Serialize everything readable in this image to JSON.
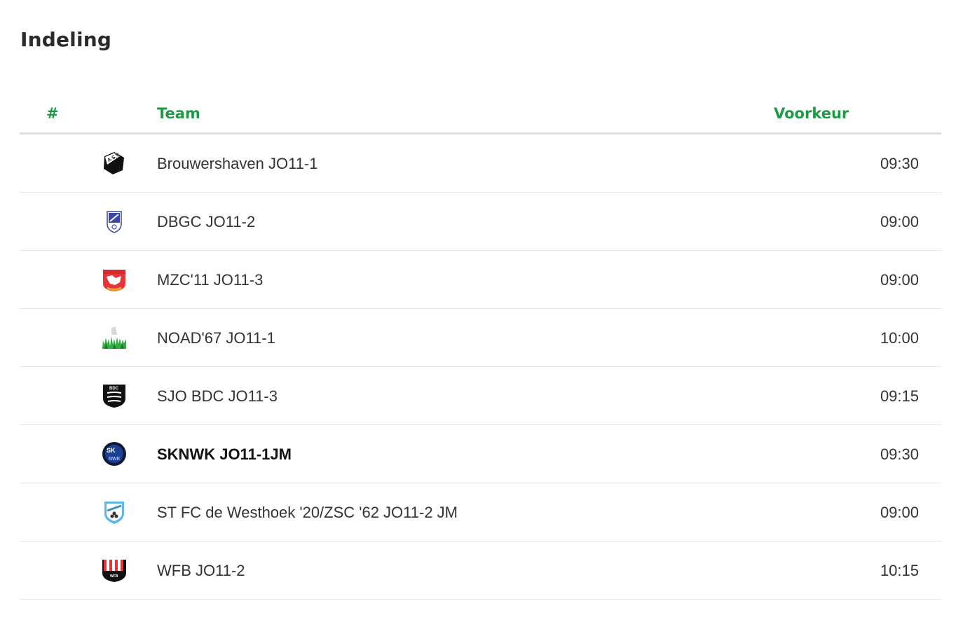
{
  "title": "Indeling",
  "table": {
    "headers": {
      "number": "#",
      "team": "Team",
      "preference": "Voorkeur"
    },
    "accent_color": "#1e9a44",
    "rows": [
      {
        "team": "Brouwershaven JO11-1",
        "preference": "09:30",
        "logo_icon": "asv-club-crest-icon",
        "highlighted": false
      },
      {
        "team": "DBGC JO11-2",
        "preference": "09:00",
        "logo_icon": "dbgc-club-crest-icon",
        "highlighted": false
      },
      {
        "team": "MZC'11 JO11-3",
        "preference": "09:00",
        "logo_icon": "mzc-club-crest-icon",
        "highlighted": false
      },
      {
        "team": "NOAD'67 JO11-1",
        "preference": "10:00",
        "logo_icon": "noad-club-crest-icon",
        "highlighted": false
      },
      {
        "team": "SJO BDC JO11-3",
        "preference": "09:15",
        "logo_icon": "bdc-club-crest-icon",
        "highlighted": false
      },
      {
        "team": "SKNWK JO11-1JM",
        "preference": "09:30",
        "logo_icon": "sknwk-club-crest-icon",
        "highlighted": true
      },
      {
        "team": "ST FC de Westhoek '20/ZSC '62 JO11-2 JM",
        "preference": "09:00",
        "logo_icon": "westhoek-club-crest-icon",
        "highlighted": false
      },
      {
        "team": "WFB JO11-2",
        "preference": "10:15",
        "logo_icon": "wfb-club-crest-icon",
        "highlighted": false
      }
    ]
  }
}
